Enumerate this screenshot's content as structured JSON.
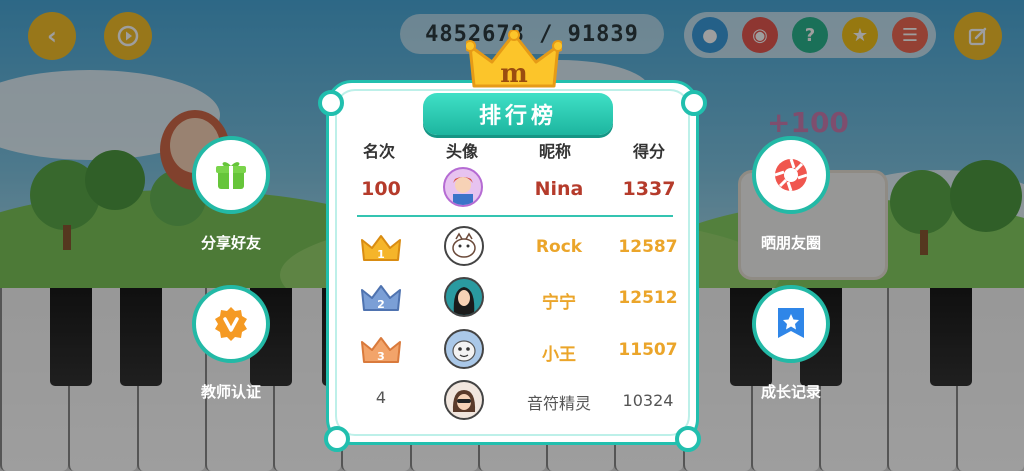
{
  "top_bar": {
    "back_icon": "chevron-left-icon",
    "play_icon": "play-icon",
    "score_text": "4852678 / 91839",
    "tools": [
      {
        "icon": "lightbulb-icon",
        "color": "#3a9bdc"
      },
      {
        "icon": "location-pin-icon",
        "color": "#e5574f"
      },
      {
        "icon": "question-icon",
        "color": "#2bb58e"
      },
      {
        "icon": "trophy-icon",
        "color": "#f2c21b"
      },
      {
        "icon": "menu-icon",
        "color": "#ef6a55"
      }
    ],
    "edit_icon": "edit-icon"
  },
  "background": {
    "plus_score": "+100"
  },
  "side_buttons": {
    "share": {
      "label": "分享好友",
      "icon": "gift-icon"
    },
    "teacher": {
      "label": "教师认证",
      "icon": "badge-v-icon"
    },
    "moments": {
      "label": "晒朋友圈",
      "icon": "camera-aperture-icon"
    },
    "growth": {
      "label": "成长记录",
      "icon": "bookmark-star-icon"
    }
  },
  "leaderboard": {
    "title": "排行榜",
    "crown_letter": "m",
    "headers": {
      "rank": "名次",
      "avatar": "头像",
      "nickname": "昵称",
      "score": "得分"
    },
    "me": {
      "rank": "100",
      "nickname": "Nina",
      "score": "1337"
    },
    "rows": [
      {
        "rank": "1",
        "nickname": "Rock",
        "score": "12587",
        "medal": "gold-crown"
      },
      {
        "rank": "2",
        "nickname": "宁宁",
        "score": "12512",
        "medal": "blue-crown"
      },
      {
        "rank": "3",
        "nickname": "小王",
        "score": "11507",
        "medal": "orange-crown"
      },
      {
        "rank": "4",
        "nickname": "音符精灵",
        "score": "10324",
        "medal": ""
      }
    ]
  },
  "colors": {
    "accent": "#21bfae",
    "my_row": "#b53b2b",
    "top_rows": "#eba52a",
    "button_yellow": "#f6c12b"
  }
}
